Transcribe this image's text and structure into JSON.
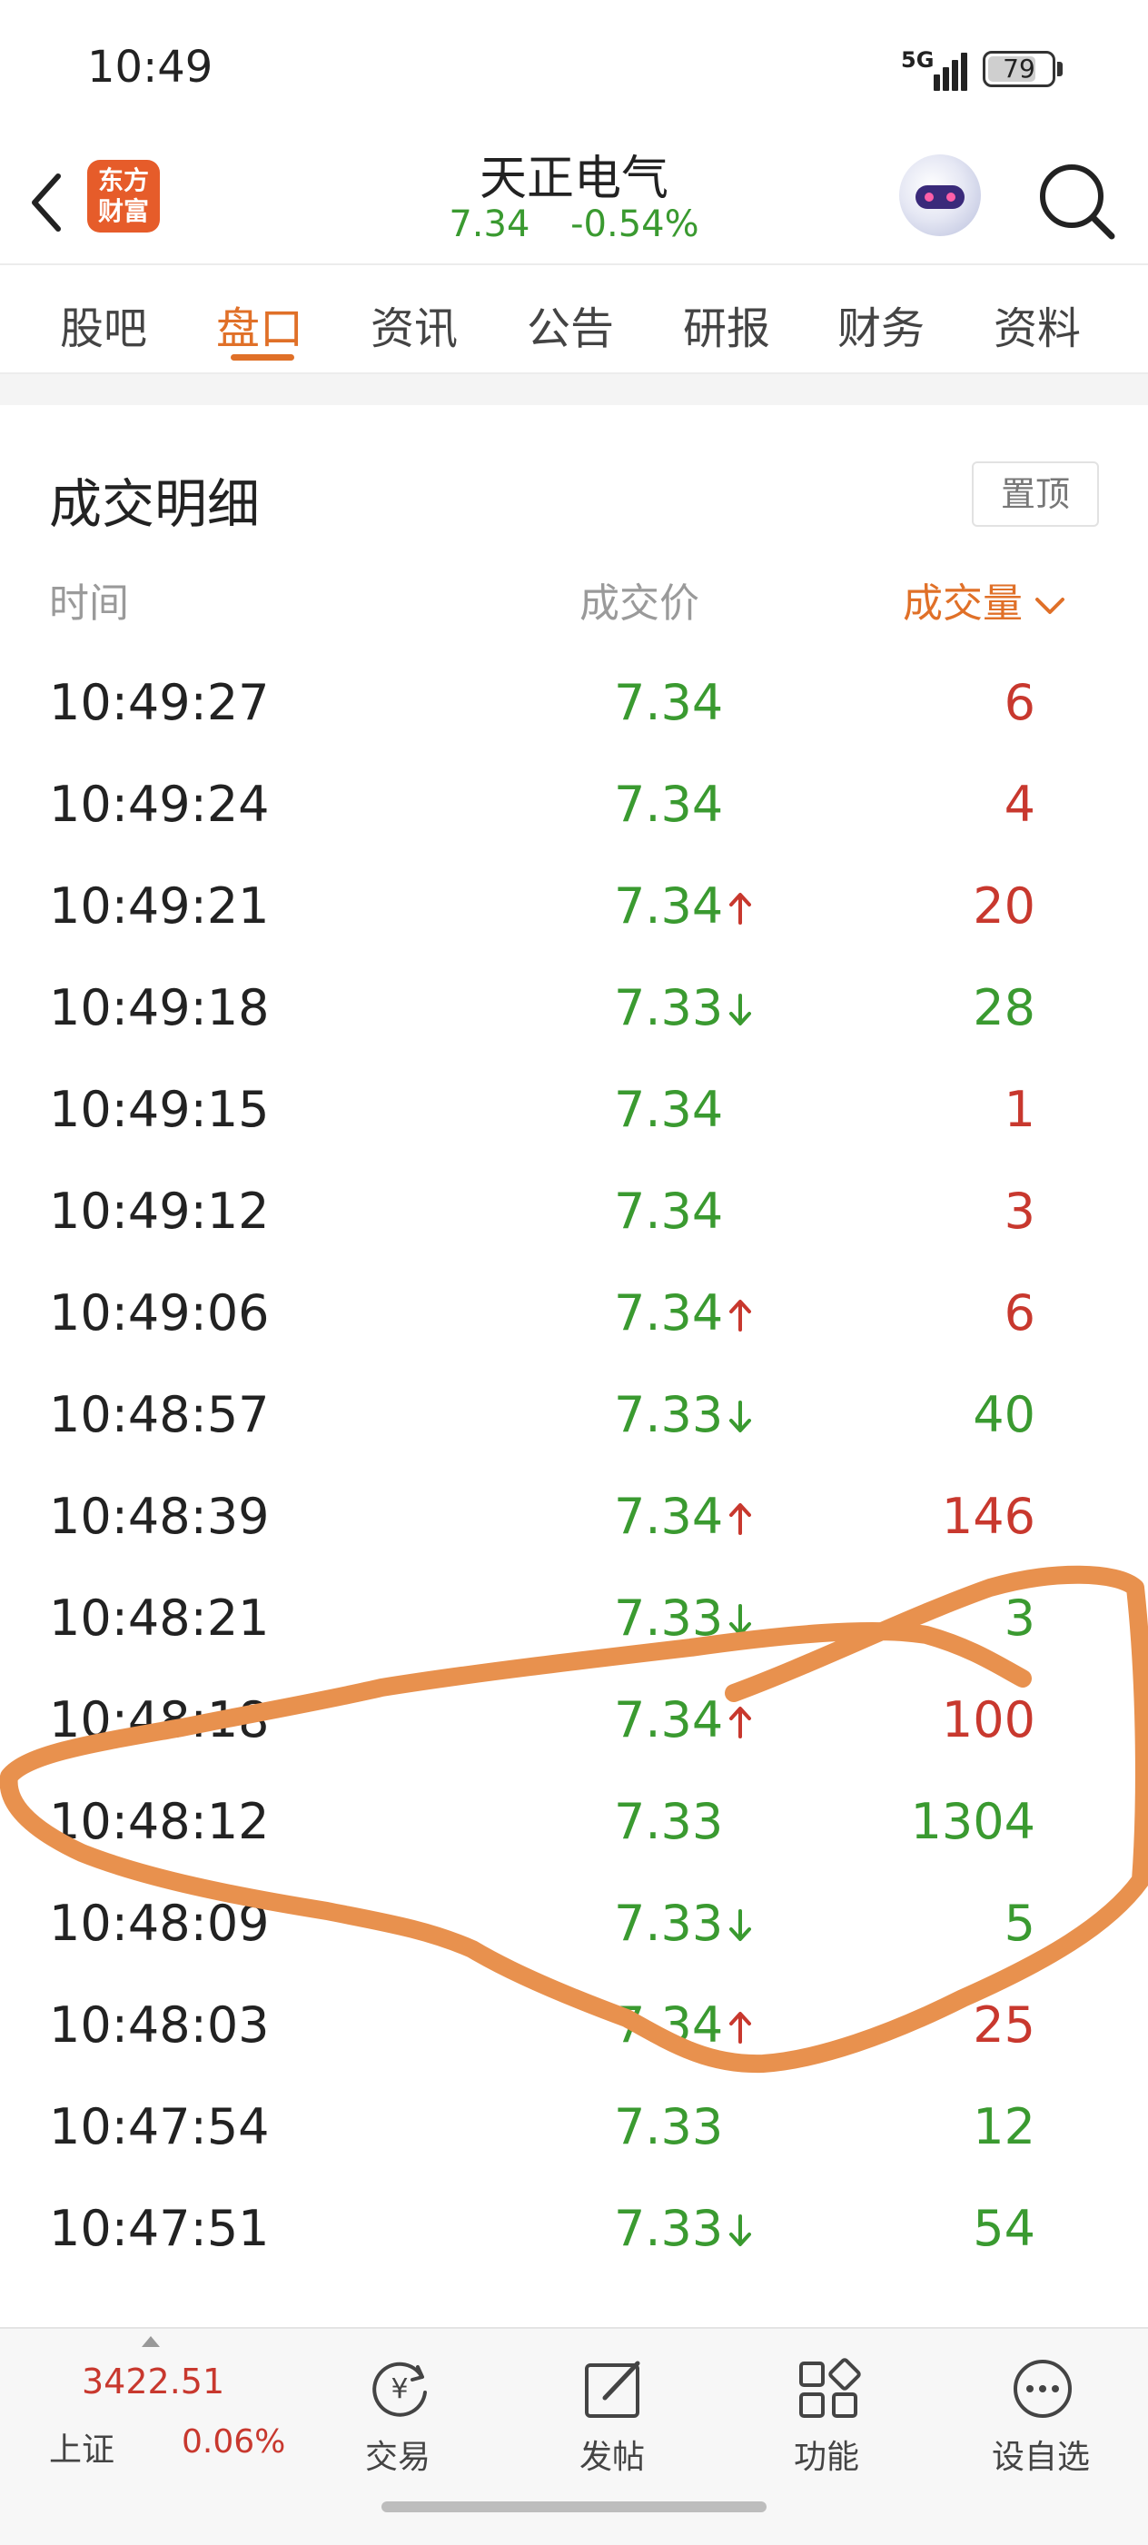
{
  "status_bar": {
    "time": "10:49",
    "network": "5G",
    "battery": "79",
    "battery_level": 0.79
  },
  "header": {
    "stock_name": "天正电气",
    "price": "7.34",
    "change": "-0.54%",
    "logo_line1": "东方",
    "logo_line2": "财富"
  },
  "tabs": [
    {
      "label": "股吧"
    },
    {
      "label": "盘口"
    },
    {
      "label": "资讯"
    },
    {
      "label": "公告"
    },
    {
      "label": "研报"
    },
    {
      "label": "财务"
    },
    {
      "label": "资料"
    }
  ],
  "active_tab": "盘口",
  "trades": {
    "title": "成交明细",
    "pin_label": "置顶",
    "columns": {
      "time": "时间",
      "price": "成交价",
      "volume": "成交量"
    },
    "rows": [
      {
        "time": "10:49:27",
        "price": "7.34",
        "arrow": "",
        "volume": "6",
        "volume_color": "red"
      },
      {
        "time": "10:49:24",
        "price": "7.34",
        "arrow": "",
        "volume": "4",
        "volume_color": "red"
      },
      {
        "time": "10:49:21",
        "price": "7.34",
        "arrow": "up",
        "volume": "20",
        "volume_color": "red"
      },
      {
        "time": "10:49:18",
        "price": "7.33",
        "arrow": "down",
        "volume": "28",
        "volume_color": "green"
      },
      {
        "time": "10:49:15",
        "price": "7.34",
        "arrow": "",
        "volume": "1",
        "volume_color": "red"
      },
      {
        "time": "10:49:12",
        "price": "7.34",
        "arrow": "",
        "volume": "3",
        "volume_color": "red"
      },
      {
        "time": "10:49:06",
        "price": "7.34",
        "arrow": "up",
        "volume": "6",
        "volume_color": "red"
      },
      {
        "time": "10:48:57",
        "price": "7.33",
        "arrow": "down",
        "volume": "40",
        "volume_color": "green"
      },
      {
        "time": "10:48:39",
        "price": "7.34",
        "arrow": "up",
        "volume": "146",
        "volume_color": "red"
      },
      {
        "time": "10:48:21",
        "price": "7.33",
        "arrow": "down",
        "volume": "3",
        "volume_color": "green"
      },
      {
        "time": "10:48:18",
        "price": "7.34",
        "arrow": "up",
        "volume": "100",
        "volume_color": "red"
      },
      {
        "time": "10:48:12",
        "price": "7.33",
        "arrow": "",
        "volume": "1304",
        "volume_color": "green"
      },
      {
        "time": "10:48:09",
        "price": "7.33",
        "arrow": "down",
        "volume": "5",
        "volume_color": "green"
      },
      {
        "time": "10:48:03",
        "price": "7.34",
        "arrow": "up",
        "volume": "25",
        "volume_color": "red"
      },
      {
        "time": "10:47:54",
        "price": "7.33",
        "arrow": "",
        "volume": "12",
        "volume_color": "green"
      },
      {
        "time": "10:47:51",
        "price": "7.33",
        "arrow": "down",
        "volume": "54",
        "volume_color": "green"
      }
    ]
  },
  "bottom_bar": {
    "index_value": "3422.51",
    "index_name": "上证",
    "index_change": "0.06%",
    "items": [
      {
        "label": "交易",
        "icon": "trade-icon"
      },
      {
        "label": "发帖",
        "icon": "post-icon"
      },
      {
        "label": "功能",
        "icon": "grid-icon"
      },
      {
        "label": "设自选",
        "icon": "more-icon"
      }
    ]
  },
  "colors": {
    "accent_orange": "#e07028",
    "up_red": "#c8382e",
    "down_green": "#3a9a30",
    "annotation_orange": "#e8914e"
  }
}
